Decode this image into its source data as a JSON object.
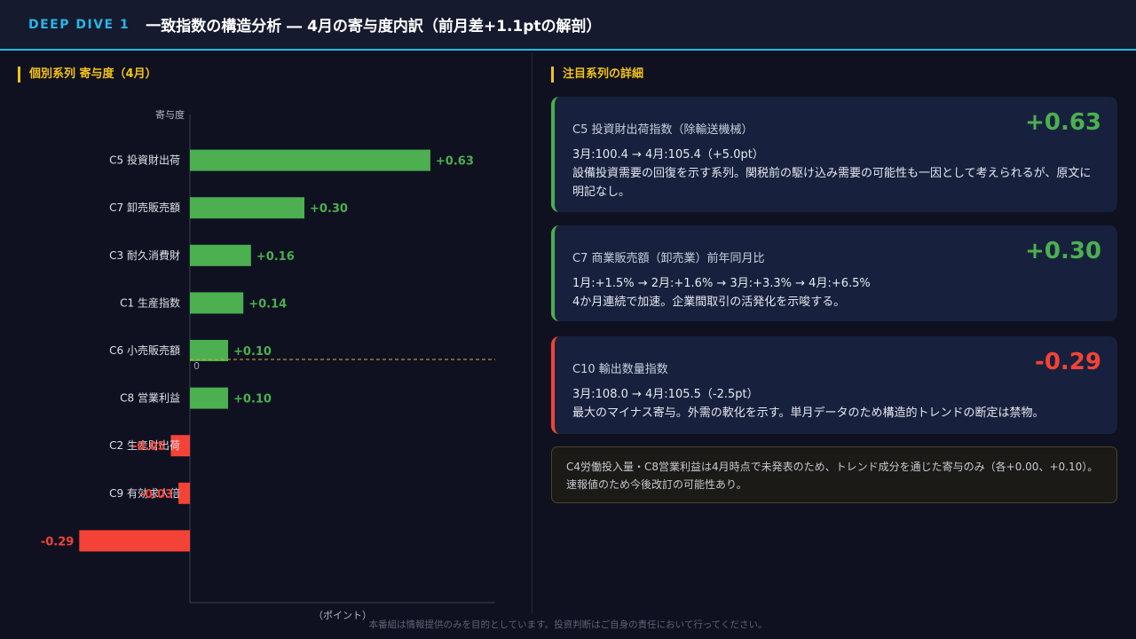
{
  "header": {
    "badge": "DEEP DIVE 1",
    "title": "一致指数の構造分析 ― 4月の寄与度内訳（前月差+1.1ptの解剖）"
  },
  "left": {
    "section_title": "個別系列 寄与度（4月）"
  },
  "chart_data": {
    "type": "bar",
    "orientation": "horizontal",
    "categories": [
      "C5 投資財出荷",
      "C7 卸売販売額",
      "C3 耐久消費財",
      "C1 生産指数",
      "C6 小売販売額",
      "C8 営業利益",
      "C2 生産財出荷",
      "C9 有効求人倍",
      ""
    ],
    "values": [
      0.63,
      0.3,
      0.16,
      0.14,
      0.1,
      0.1,
      -0.05,
      -0.03,
      -0.29
    ],
    "labels": [
      "+0.63",
      "+0.30",
      "+0.16",
      "+0.14",
      "+0.10",
      "+0.10",
      "-0.05",
      "-0.03",
      "-0.29"
    ],
    "xlabel": "（ポイント）",
    "ylabel": "寄与度",
    "zero_label": "0",
    "colors": {
      "positive": "#4caf50",
      "negative": "#f44336"
    }
  },
  "right": {
    "section_title": "注目系列の詳細",
    "cards": [
      {
        "name": "C5 投資財出荷指数（除輸送機械）",
        "value": "+0.63",
        "line1": "3月:100.4 → 4月:105.4（+5.0pt）",
        "line2": "設備投資需要の回復を示す系列。関税前の駆け込み需要の可能性も一因として考えられるが、原文に明記なし。"
      },
      {
        "name": "C7 商業販売額（卸売業）前年同月比",
        "value": "+0.30",
        "line1": "1月:+1.5% → 2月:+1.6% → 3月:+3.3% → 4月:+6.5%",
        "line2": "4か月連続で加速。企業間取引の活発化を示唆する。"
      },
      {
        "name": "C10 輸出数量指数",
        "value": "-0.29",
        "line1": "3月:108.0 → 4月:105.5（-2.5pt）",
        "line2": "最大のマイナス寄与。外需の軟化を示す。単月データのため構造的トレンドの断定は禁物。"
      }
    ],
    "note": "C4労働投入量・C8営業利益は4月時点で未発表のため、トレンド成分を通じた寄与のみ（各+0.00、+0.10）。速報値のため今後改訂の可能性あり。"
  },
  "footer": "本番組は情報提供のみを目的としています。投資判断はご自身の責任において行ってください。"
}
